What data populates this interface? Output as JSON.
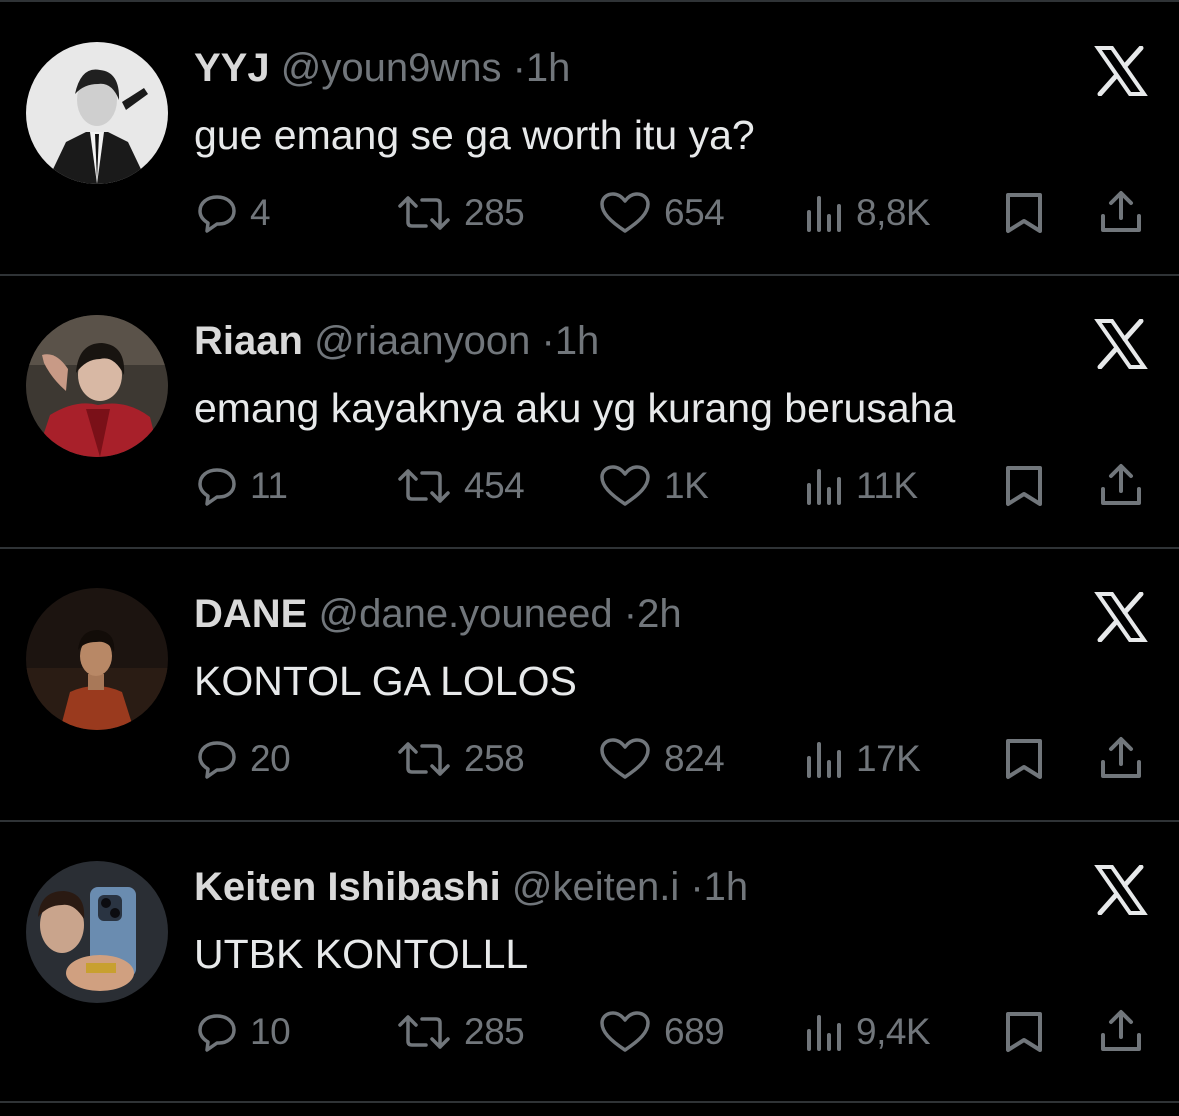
{
  "tweets": [
    {
      "name": "YYJ",
      "handle": "@youn9wns",
      "dot": "·",
      "time": "1h",
      "text": "gue emang se ga worth itu ya?",
      "replies": "4",
      "retweets": "285",
      "likes": "654",
      "views": "8,8K"
    },
    {
      "name": "Riaan",
      "handle": "@riaanyoon",
      "dot": "·",
      "time": "1h",
      "text": "emang kayaknya aku yg kurang berusaha",
      "replies": "11",
      "retweets": "454",
      "likes": "1K",
      "views": "11K"
    },
    {
      "name": "DANE",
      "handle": "@dane.youneed",
      "dot": "·",
      "time": "2h",
      "text": "KONTOL GA LOLOS",
      "replies": "20",
      "retweets": "258",
      "likes": "824",
      "views": "17K"
    },
    {
      "name": "Keiten Ishibashi",
      "handle": "@keiten.i",
      "dot": "·",
      "time": "1h",
      "text": "UTBK KONTOLLL",
      "replies": "10",
      "retweets": "285",
      "likes": "689",
      "views": "9,4K"
    }
  ],
  "icons": {
    "reply": "reply-icon",
    "retweet": "retweet-icon",
    "like": "heart-icon",
    "views": "views-icon",
    "bookmark": "bookmark-icon",
    "share": "share-icon",
    "brand": "x-logo-icon"
  },
  "colors": {
    "background": "#000000",
    "text": "#e7e9ea",
    "secondary": "#71767b",
    "divider": "#2f3336"
  }
}
